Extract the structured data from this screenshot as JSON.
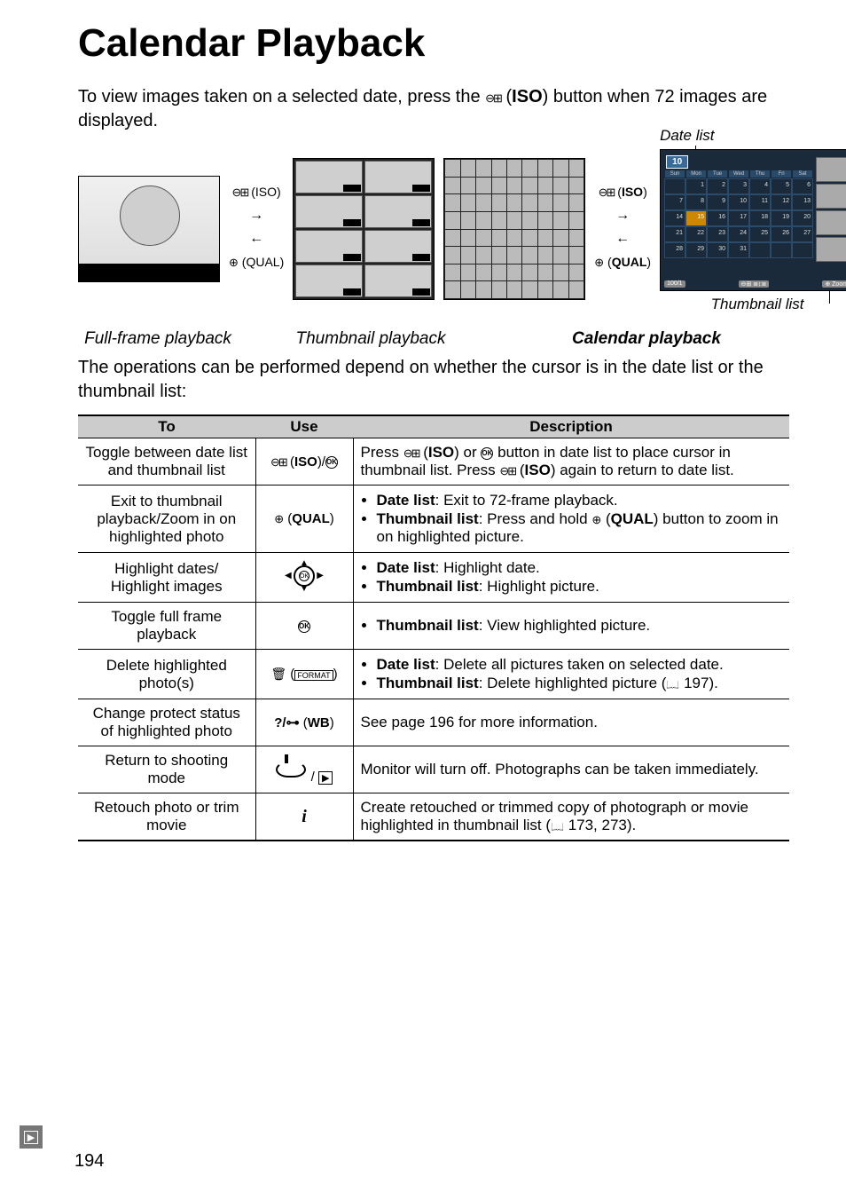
{
  "title": "Calendar Playback",
  "intro": "To view images taken on a selected date, press the ⊖⊞ (ISO) button when 72 images are displayed.",
  "figures": {
    "fullframe_label": "Full-frame playback",
    "thumbnail_playback_label": "Thumbnail playback",
    "calendar_playback_label": "Calendar playback",
    "date_list_label": "Date list",
    "thumbnail_list_label": "Thumbnail list",
    "arrow_up_label": "(ISO)",
    "arrow_down_label": "(QUAL)",
    "calendar_month": "10",
    "calendar_days": [
      "Sun",
      "Mon",
      "Tue",
      "Wed",
      "Thu",
      "Fri",
      "Sat"
    ],
    "calendar_footer1": "⊖⊞",
    "calendar_footer2": "⊕ Zoom"
  },
  "body_text": "The operations can be performed depend on whether the cursor is in the date list or the thumbnail list:",
  "table": {
    "headers": {
      "to": "To",
      "use": "Use",
      "description": "Description"
    },
    "rows": [
      {
        "to": "Toggle between date list and thumbnail list",
        "use_html": "<span class='iso-sym'></span> (<b>ISO</b>)/<span class='ok-circle'>OK</span>",
        "desc_html": "Press <span class='iso-sym'></span> (<b>ISO</b>) or <span class='ok-circle'>OK</span> button in date list to place cursor in thumbnail list.  Press <span class='iso-sym'></span> (<b>ISO</b>) again to return to date list."
      },
      {
        "to": "Exit to thumbnail playback/Zoom in on highlighted photo",
        "use_html": "<span class='qual-sym'></span> (<b>QUAL</b>)",
        "desc_html": "<ul><li><b>Date list</b>: Exit to 72-frame playback.</li><li><b>Thumbnail list</b>: Press and hold <span class='qual-sym'></span> (<b>QUAL</b>) button to zoom in on highlighted picture.</li></ul>"
      },
      {
        "to": "Highlight dates/\nHighlight images",
        "use_html": "<span class='multi-selector'><span class='ring'></span><span class='ok'>OK</span><span class='l'>◀</span><span class='r'>▶</span></span>",
        "desc_html": "<ul><li><b>Date list</b>: Highlight date.</li><li><b>Thumbnail list</b>: Highlight picture.</li></ul>"
      },
      {
        "to": "Toggle full frame playback",
        "use_html": "<span class='ok-circle'>OK</span>",
        "desc_html": "<ul><li><b>Thumbnail list</b>: View highlighted picture.</li></ul>"
      },
      {
        "to": "Delete highlighted photo(s)",
        "use_html": "<span class='trash'></span> (<span style='border:1px solid #000; font-size:9px; padding:0 2px;'>FORMAT</span>)",
        "desc_html": "<ul><li><b>Date list</b>: Delete all pictures taken on selected date.</li><li><b>Thumbnail list</b>: Delete highlighted picture (<span class='book'></span> 197).</li></ul>"
      },
      {
        "to": "Change protect status of highlighted photo",
        "use_html": "<b>?/⊶</b> (<b>WB</b>)",
        "desc_html": "See page 196 for more information."
      },
      {
        "to": "Return to shooting mode",
        "use_html": "<span class='shutter'></span> / <span class='play-box'>▶</span>",
        "desc_html": "Monitor will turn off.  Photographs can be taken immediately."
      },
      {
        "to": "Retouch photo or trim movie",
        "use_html": "<span class='info-i'>i</span>",
        "desc_html": "Create retouched or trimmed copy of  photograph or movie highlighted in thumbnail list (<span class='book'></span> 173, 273)."
      }
    ]
  },
  "page_number": "194"
}
